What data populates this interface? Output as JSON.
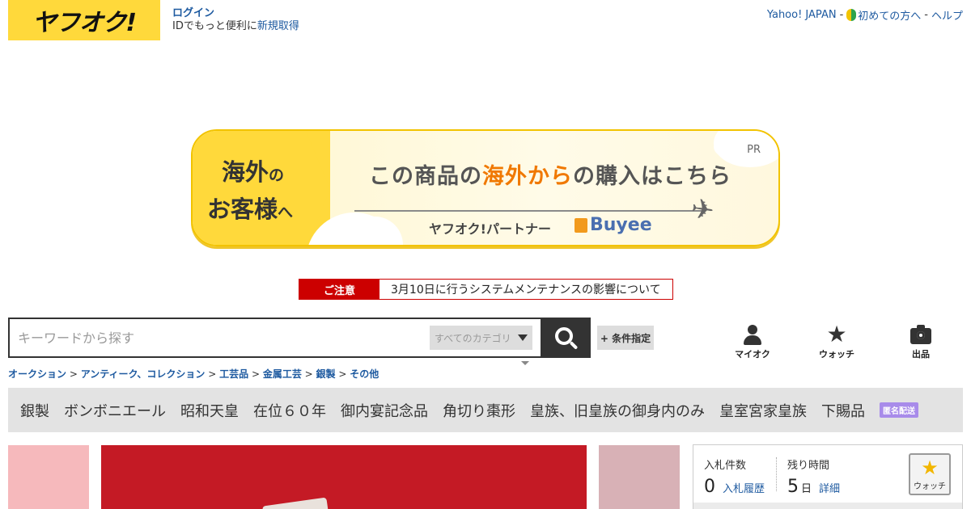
{
  "header": {
    "logo": "ヤフオク!",
    "login_label": "ログイン",
    "login_sub_prefix": "IDでもっと便利に",
    "register_link": "新規取得",
    "links": {
      "yahoo_japan": "Yahoo! JAPAN",
      "sep1": "-",
      "beginner": "初めての方へ",
      "sep2": "-",
      "help": "ヘルプ"
    }
  },
  "banner": {
    "left_line1": "海外",
    "left_line1_small": "の",
    "left_line2": "お客様",
    "left_line2_small": "へ",
    "main_pre": "この商品の",
    "main_highlight": "海外から",
    "main_post": "の購入はこちら",
    "partner": "ヤフオク!パートナー",
    "brand": "Buyee",
    "pr": "PR",
    "accent_color": "#f07800"
  },
  "notice": {
    "tag": "ご注意",
    "message": "3月10日に行うシステムメンテナンスの影響について"
  },
  "search": {
    "placeholder": "キーワードから探す",
    "value": "",
    "category_selected": "すべてのカテゴリ",
    "condition_button": "+ 条件指定",
    "search_icon": "search-icon"
  },
  "quick_links": [
    {
      "label": "マイオク",
      "icon": "user-icon"
    },
    {
      "label": "ウォッチ",
      "icon": "star-icon"
    },
    {
      "label": "出品",
      "icon": "camera-icon"
    }
  ],
  "breadcrumb": [
    "オークション",
    "アンティーク、コレクション",
    "工芸品",
    "金属工芸",
    "銀製",
    "その他"
  ],
  "tags": [
    "銀製",
    "ボンボニエール",
    "昭和天皇",
    "在位６０年",
    "御内宴記念品",
    "角切り棗形",
    "皇族、旧皇族の御身内のみ",
    "皇室宮家皇族",
    "下賜品"
  ],
  "anon_badge": "匿名配送",
  "info": {
    "bids_label": "入札件数",
    "bids_value": "0",
    "bids_link": "入札履歴",
    "time_label": "残り時間",
    "time_value": "5",
    "time_unit": "日",
    "time_link": "詳細",
    "watch_label": "ウォッチ"
  }
}
